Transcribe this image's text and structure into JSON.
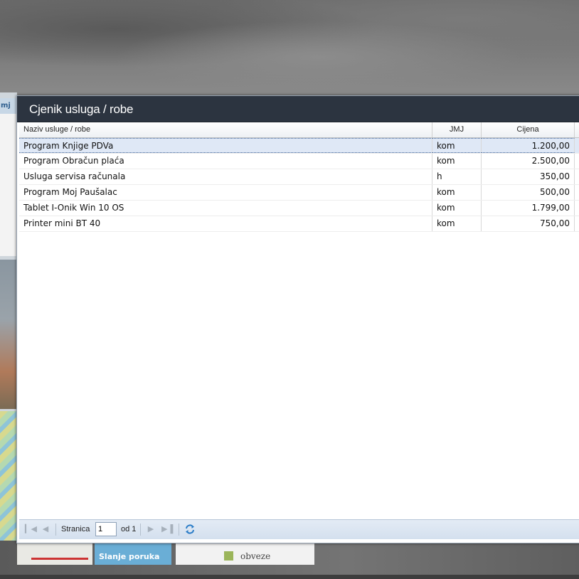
{
  "background": {
    "left_tab_text": "mj",
    "tile_blue_label": "Slanje poruka",
    "tile_white_label": "obveze"
  },
  "dialog": {
    "title": "Cjenik usluga / robe",
    "columns": {
      "name": "Naziv usluge / robe",
      "unit": "JMJ",
      "price": "Cijena"
    },
    "rows": [
      {
        "name": "Program Knjige PDVa",
        "unit": "kom",
        "price": "1.200,00"
      },
      {
        "name": "Program Obračun plaća",
        "unit": "kom",
        "price": "2.500,00"
      },
      {
        "name": "Usluga servisa računala",
        "unit": "h",
        "price": "350,00"
      },
      {
        "name": "Program Moj Paušalac",
        "unit": "kom",
        "price": "500,00"
      },
      {
        "name": "Tablet I-Onik Win 10 OS",
        "unit": "kom",
        "price": "1.799,00"
      },
      {
        "name": "Printer mini BT 40",
        "unit": "kom",
        "price": "750,00"
      }
    ],
    "selected_row_index": 0,
    "paging": {
      "page_label": "Stranica",
      "page_value": "1",
      "of_label": "od 1"
    }
  },
  "colors": {
    "header_bg": "#2c3440",
    "selected_row": "#dfe8f6",
    "toolbar_bg": "#d4e0ee"
  }
}
